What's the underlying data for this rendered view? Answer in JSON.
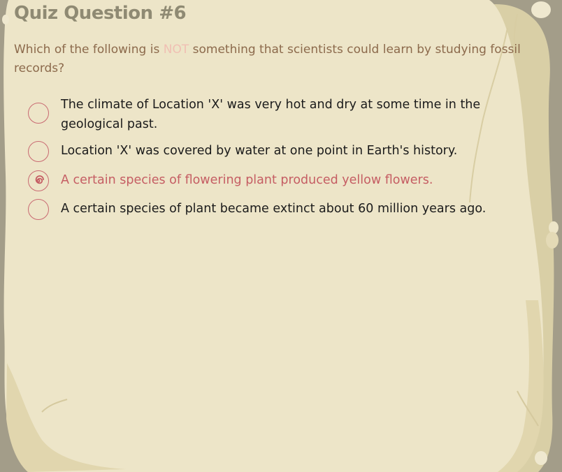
{
  "quiz": {
    "title": "Quiz Question #6",
    "question": {
      "before": "Which of the following is ",
      "highlight": "NOT",
      "after": " something that scientists could learn by studying fossil records?"
    },
    "options": [
      {
        "text": "The climate of Location 'X' was very hot and dry at some time in the geological past.",
        "selected": false
      },
      {
        "text": "Location 'X' was covered by water at one point in Earth's history.",
        "selected": false
      },
      {
        "text": "A certain species of flowering plant produced yellow flowers.",
        "selected": true
      },
      {
        "text": "A certain species of plant became extinct about 60 million years ago.",
        "selected": false
      }
    ]
  },
  "colors": {
    "background": "#a39d89",
    "parchment": "#ede5c8",
    "parchment_edge": "#e1d6ae",
    "title": "#8f8a73",
    "question_text": "#8c6a4c",
    "highlight": "#f0bfb3",
    "option_text": "#1b1b1b",
    "selected_accent": "#c55d63"
  }
}
